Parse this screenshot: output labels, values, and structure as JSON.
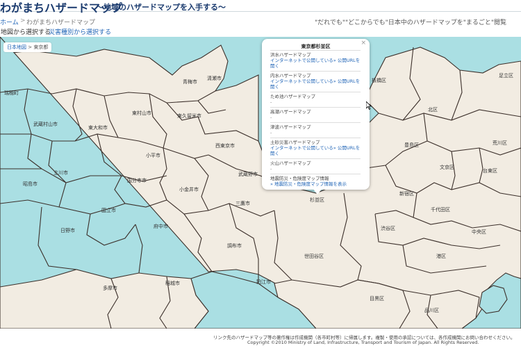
{
  "header": {
    "title": "わがまちハザードマップ",
    "subtitle": "～地域のハザードマップを入手する～"
  },
  "breadcrumb": {
    "home": "ホーム",
    "separator": ">",
    "current": "わがまちハザードマップ",
    "tagline": "\"だれでも\"\"どこからでも\"日本中のハザードマップを\"まるごと\"閲覧"
  },
  "tabs": [
    {
      "label": "地図から選択する"
    },
    {
      "label": "災害種別から選択する"
    }
  ],
  "map_breadcrumb": {
    "root": "日本地図",
    "separator": ">",
    "current": "東京都"
  },
  "popup": {
    "close": "×",
    "title": "東京都杉並区",
    "items": [
      {
        "name": "洪水ハザードマップ",
        "link": "インターネットで公開している» 公開URLを開く"
      },
      {
        "name": "内水ハザードマップ",
        "link": "インターネットで公開している» 公開URLを開く"
      },
      {
        "name": "ため池ハザードマップ",
        "link": "-"
      },
      {
        "name": "高潮ハザードマップ",
        "link": "-"
      },
      {
        "name": "津波ハザードマップ",
        "link": "-"
      },
      {
        "name": "土砂災害ハザードマップ",
        "link": "インターネットで公開している» 公開URLを開く"
      },
      {
        "name": "火山ハザードマップ",
        "link": "-"
      },
      {
        "name": "地震防災・危険度マップ情報",
        "link": "» 地震防災・危険度マップ情報を表示"
      }
    ]
  },
  "cities": [
    "瑞穂町",
    "青梅市",
    "武蔵村山市",
    "東大和市",
    "東村山市",
    "東久留米市",
    "清瀬市",
    "立川市",
    "昭島市",
    "国分寺市",
    "小平市",
    "西東京市",
    "武蔵野市",
    "小金井市",
    "国立市",
    "日野市",
    "府中市",
    "三鷹市",
    "調布市",
    "狛江市",
    "稲城市",
    "多摩市",
    "世田谷区",
    "杉並区",
    "板橋区",
    "北区",
    "足立区",
    "荒川区",
    "豊島区",
    "文京区",
    "台東区",
    "新宿区",
    "千代田区",
    "中央区",
    "渋谷区",
    "港区",
    "目黒区",
    "品川区"
  ],
  "footer": {
    "note": "リンク先のハザードマップ等の著作権は作成機関（各市町村等）に帰属します。複製・使用の承認については、各作成機関にお問い合わせください。",
    "copyright": "Copyright ©2010 Ministry of Land, Infrastructure, Transport and Tourism of Japan. All Rights Reserved."
  },
  "colors": {
    "land": "#f2ece2",
    "water": "#aadfe3",
    "border": "#3b2f2a",
    "link": "#1e63b6",
    "title": "#1a3a6e"
  }
}
